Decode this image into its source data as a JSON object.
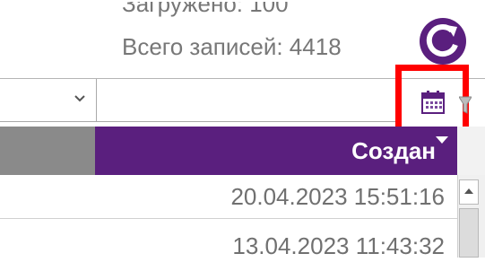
{
  "status": {
    "loaded_text": "Загружено: 100",
    "total_text": "Всего записей: 4418"
  },
  "icons": {
    "refresh": "refresh-icon",
    "calendar": "calendar-icon",
    "funnel": "funnel-icon",
    "dropdown": "chevron-down-icon",
    "sort": "sort-down-icon"
  },
  "grid": {
    "column_header": "Создан",
    "rows": [
      {
        "created": "20.04.2023 15:51:16"
      },
      {
        "created": "13.04.2023 11:43:32"
      }
    ]
  },
  "colors": {
    "header_bg": "#5a1f7e",
    "highlight": "#ff0000",
    "refresh": "#5a1f7e"
  }
}
